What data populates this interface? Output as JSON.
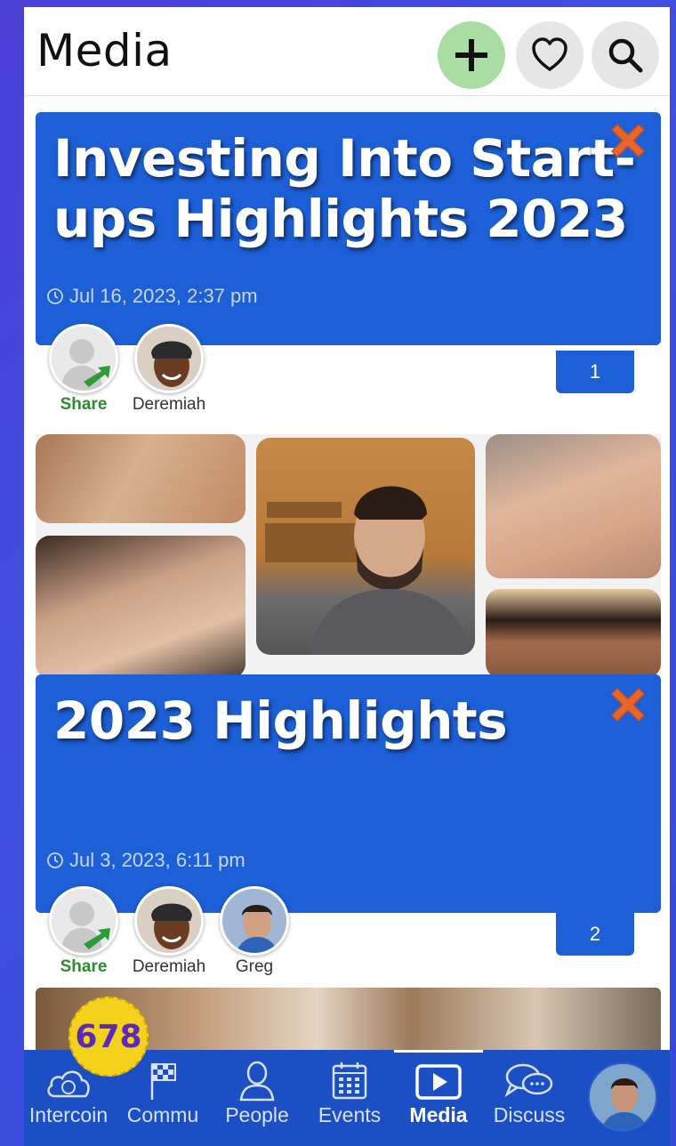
{
  "header": {
    "title": "Media",
    "add_icon": "plus-icon",
    "favorite_icon": "heart-icon",
    "search_icon": "search-icon"
  },
  "cards": [
    {
      "title_line1": "Investing Into Start-",
      "title_line2": "ups Highlights 2023",
      "date": "Jul 16, 2023, 2:37 pm",
      "count": "1",
      "people": [
        {
          "name": "Share"
        },
        {
          "name": "Deremiah"
        }
      ]
    },
    {
      "title_line1": "2023 Highlights",
      "date": "Jul 3, 2023, 6:11 pm",
      "count": "2",
      "people": [
        {
          "name": "Share"
        },
        {
          "name": "Deremiah"
        },
        {
          "name": "Greg"
        }
      ]
    }
  ],
  "bottom_nav": {
    "coin_count": "678",
    "items": [
      {
        "label": "Intercoin",
        "icon": "cloud-coin-icon"
      },
      {
        "label": "Commu",
        "icon": "flag-icon"
      },
      {
        "label": "People",
        "icon": "person-icon"
      },
      {
        "label": "Events",
        "icon": "calendar-icon"
      },
      {
        "label": "Media",
        "icon": "play-icon",
        "active": true
      },
      {
        "label": "Discuss",
        "icon": "chat-icon"
      }
    ]
  },
  "colors": {
    "accent": "#1d5fd6",
    "nav_bg": "#1c4fc4",
    "add_button": "#a9dda3",
    "close": "#e8662a",
    "badge": "#f4d21c"
  }
}
